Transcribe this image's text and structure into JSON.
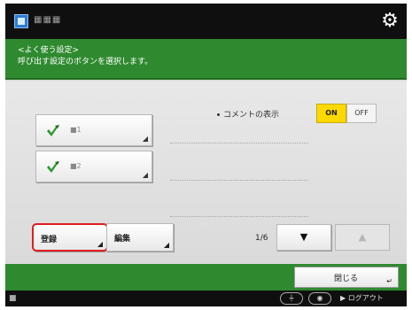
{
  "header": {
    "app_title": "▦▦▦",
    "icon": "app-icon",
    "settings_icon": "gear-icon"
  },
  "instructions": {
    "line1": "<よく使う設定>",
    "line2": "呼び出す設定のボタンを選択します。"
  },
  "comment_display": {
    "label": "コメントの表示",
    "on_label": "ON",
    "off_label": "OFF",
    "selected": "ON"
  },
  "favorites": [
    {
      "label": "■1",
      "icon": "green-check-icon"
    },
    {
      "label": "■2",
      "icon": "green-check-icon"
    }
  ],
  "actions": {
    "register_label": "登録",
    "edit_label": "編集"
  },
  "pagination": {
    "page_indicator": "1/6",
    "down_label": "▼",
    "up_label": "▲"
  },
  "footer": {
    "close_label": "閉じる"
  },
  "statusbar": {
    "pill1_label": "⏚",
    "pill2_label": "◉",
    "logout_label": "ログアウト"
  },
  "colors": {
    "topbar": "#0f0f0f",
    "instruction_bar": "#2f8a2f",
    "toggle_on": "#ffd900",
    "highlight_border": "#e01e1e"
  }
}
